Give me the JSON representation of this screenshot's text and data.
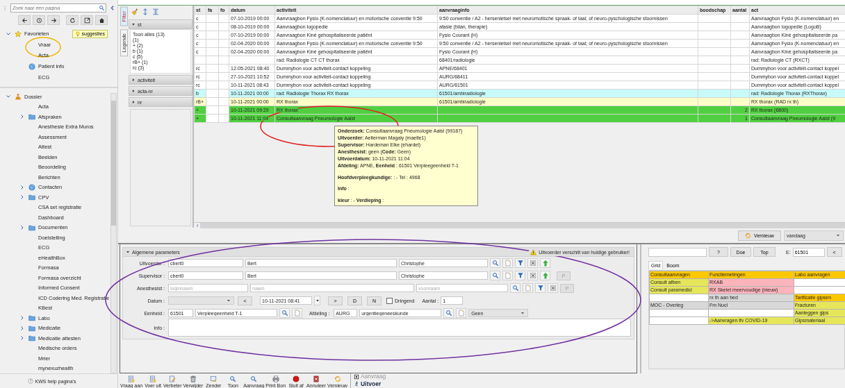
{
  "sidebar": {
    "search": {
      "placeholder": "Zoek naar een pagina"
    },
    "favorites": {
      "label": "Favorieten",
      "expanded": true,
      "suggest_button": "suggesties",
      "items": [
        {
          "label": "Vraar",
          "kind": "page"
        },
        {
          "label": "Acta",
          "kind": "page"
        },
        {
          "label": "Patient info",
          "kind": "globe"
        },
        {
          "label": "ECG",
          "kind": "page"
        }
      ]
    },
    "tree": [
      {
        "label": "Dossier",
        "kind": "person",
        "expanded": true,
        "children": [
          {
            "label": "Acta",
            "kind": "page"
          },
          {
            "label": "Afspraken",
            "kind": "folder",
            "expanded": false
          },
          {
            "label": "Anesthesie Extra Muros",
            "kind": "page"
          },
          {
            "label": "Assessment",
            "kind": "page"
          },
          {
            "label": "Attest",
            "kind": "page"
          },
          {
            "label": "Beelden",
            "kind": "page"
          },
          {
            "label": "Beoordeling",
            "kind": "page"
          },
          {
            "label": "Berichten",
            "kind": "page"
          },
          {
            "label": "Contacten",
            "kind": "globe",
            "expanded": false
          },
          {
            "label": "CPV",
            "kind": "folder",
            "expanded": false
          },
          {
            "label": "CSA set registratie",
            "kind": "page"
          },
          {
            "label": "Dashboard",
            "kind": "page"
          },
          {
            "label": "Documenten",
            "kind": "folder",
            "expanded": false
          },
          {
            "label": "Doelstelling",
            "kind": "page"
          },
          {
            "label": "ECG",
            "kind": "page"
          },
          {
            "label": "eHealthBox",
            "kind": "page"
          },
          {
            "label": "Formasa",
            "kind": "page"
          },
          {
            "label": "Formasa overzicht",
            "kind": "page"
          },
          {
            "label": "Informed Consent",
            "kind": "page"
          },
          {
            "label": "ICD Codering Med. Registratie",
            "kind": "page"
          },
          {
            "label": "KBest",
            "kind": "page"
          },
          {
            "label": "Labo",
            "kind": "folder",
            "expanded": false
          },
          {
            "label": "Medicatie",
            "kind": "folder",
            "expanded": false
          },
          {
            "label": "Medicatie attesten",
            "kind": "folder",
            "expanded": false
          },
          {
            "label": "Medische orders",
            "kind": "page"
          },
          {
            "label": "Mrier",
            "kind": "page"
          },
          {
            "label": "mynexuzhealth",
            "kind": "page"
          }
        ]
      }
    ],
    "help_link": "KWS help pagina's"
  },
  "filter": {
    "tabs": [
      {
        "label": "Filter",
        "selected": true
      },
      {
        "label": "Legende",
        "selected": false
      }
    ],
    "groups": [
      {
        "label": "st",
        "expanded": true,
        "options": [
          "Toon alles (13)",
          "(1)",
          "+ (2)",
          "b (1)",
          "c (5)",
          "rB+ (1)",
          "rc (3)"
        ]
      },
      {
        "label": "activiteit",
        "expanded": false
      },
      {
        "label": "acta-nr",
        "expanded": false
      },
      {
        "label": "nr",
        "expanded": false
      }
    ]
  },
  "table": {
    "columns": [
      "st",
      "fa",
      "fo",
      "datum",
      "activiteit",
      "aanvraaginfo",
      "boodschap",
      "aantal",
      "act"
    ],
    "rows": [
      {
        "st": "c",
        "datum": "07-10-2019 00:00",
        "activiteit": "Aanvraagbon Fysio (K-nomenclatuur) en motorische conventie 9:50",
        "aanvraaginfo": "9:50 conventie / A2 - hersenletsel met neuromotische spraak- of taal; of neuro-pyschologische stoornissen",
        "act": "Aanvraagbon Fysio (K-nomenclatuur) en",
        "color": "#ffffff"
      },
      {
        "st": "c",
        "datum": "08-10-2019 00:00",
        "activiteit": "Aanvraagbon logopedie",
        "aanvraaginfo": "afasie (bilan, therapie)",
        "act": "Aanvraagbon logopedie (LogoB)",
        "color": "#ffffff"
      },
      {
        "st": "c",
        "datum": "07-10-2019 00:00",
        "activiteit": "Aanvraagbon Kiné gehospitaliseerde patiënt",
        "aanvraaginfo": "Fysio Courant (H)",
        "act": "Aanvraagbon Kiné gehospitaliseerde pa",
        "color": "#ffffff"
      },
      {
        "st": "c",
        "datum": "02-04-2020 00:00",
        "activiteit": "Aanvraagbon Fysio (K-nomenclatuur) en motorische conventie 9:50",
        "aanvraaginfo": "9:50 conventie / A2 - hersenletsel met neuromotische spraak- of taal; of neuro-pyschologische stoornissen",
        "act": "Aanvraagbon Fysio (K-nomenclatuur) en",
        "color": "#ffffff"
      },
      {
        "st": "c",
        "datum": "02-04-2020 00:00",
        "activiteit": "Aanvraagbon Kiné gehospitaliseerde patiënt",
        "aanvraaginfo": "Fysio Courant (H)",
        "act": "Aanvraagbon Kiné gehospitaliseerde pa",
        "color": "#ffffff"
      },
      {
        "activiteit": "rad: Radiologie CT CT thorax",
        "aanvraaginfo": "68401/radiologie",
        "act": "rad: Radiologie CT (RXCT)",
        "color": "#ffffff"
      },
      {
        "st": "rc",
        "datum": "12-05-2021 08:40",
        "activiteit": "Dummybon voor activiteit-contact koppeling",
        "aanvraaginfo": "APNE/68401",
        "act": "Dummybon voor activiteit-contact koppel",
        "color": "#ffffff"
      },
      {
        "st": "rc",
        "datum": "27-10-2021 10:52",
        "activiteit": "Dummybon voor activiteit-contact koppeling",
        "aanvraaginfo": "AURG/68411",
        "act": "Dummybon voor activiteit-contact koppel",
        "color": "#ffffff"
      },
      {
        "st": "rc",
        "datum": "10-11-2021 08:43",
        "activiteit": "Dummybon voor activiteit-contact koppeling",
        "aanvraaginfo": "AURG/61501",
        "act": "Dummybon voor activiteit-contact koppel",
        "color": "#ffffff"
      },
      {
        "st": "b",
        "datum": "10-11-2021 00:00",
        "activiteit": "rad: Radiologie Thorax RX thorax",
        "aanvraaginfo": "61501/ambiradiologie",
        "act": "rad: Radiologie Thorax (RXThorax)",
        "color": "#c8fafa"
      },
      {
        "st": "rB+",
        "datum": "10-11-2021 00:00",
        "activiteit": "RX thorax",
        "aanvraaginfo": "61501/ambiradiologie",
        "act": "RX thorax (RAD rx th)",
        "color": "#ffffc8"
      },
      {
        "st": "+",
        "datum": "10-11-2021 09:29",
        "activiteit": "RX thorax",
        "aantal": "2",
        "act": "RX thorax (6800)",
        "color": "#50d040"
      },
      {
        "st": "+",
        "datum": "10-11-2021 11:04",
        "activiteit": "Consultaanvraag Pneumologie Aalst",
        "aantal": "1",
        "act": "Consultaanvraag Pneumologie Aalst (9",
        "color": "#50d040"
      }
    ]
  },
  "tooltip": {
    "sections": [
      [
        "**Onderzoek:** Consultaanvraag Pneumologie Aalst (99187)",
        "**Uitvoerder:** Aelterman Magaly (maelte1)",
        "**Supervisor:** Hardeman Elke (ehardel)",
        "**Anesthesist:** geen (**Code:** Geen)",
        "**Uitvoerdatum:** 10-11-2021 11:04",
        "**Afdeling:** APNE, **Eenheid** : 61501 Verpleegeenheid T-1"
      ],
      [
        "**Hoofdverpleegkundige:** : - Tel : 4968"
      ],
      [
        "**Info** :"
      ],
      [
        "**kleur** : - **Verdieping** :"
      ]
    ]
  },
  "refresh": {
    "button": "Vernieuw",
    "period": "vandaag"
  },
  "form": {
    "title": "Algemene parameters",
    "expanded": true,
    "warning": "Uitvoerder verschilt van huidige gebruiker!",
    "rows": [
      {
        "kind": "person",
        "label": "Uitvoerder :",
        "login": {
          "value": "cbert0"
        },
        "name": {
          "value": "Bert"
        },
        "firstname": {
          "value": "Christophe"
        },
        "arrow": true
      },
      {
        "kind": "person",
        "label": "Supervisor :",
        "login": {
          "value": "cbert0"
        },
        "name": {
          "value": "Bert"
        },
        "firstname": {
          "value": "Christophe"
        },
        "arrow": true,
        "p_button": {
          "label": "P",
          "disabled": true
        }
      },
      {
        "kind": "person",
        "label": "Anesthesist :",
        "login": {
          "placeholder": "loginnaam"
        },
        "name": {
          "placeholder": "naam"
        },
        "firstname": {
          "placeholder": "voornaam"
        },
        "arrow": false,
        "p_button": {
          "label": "P",
          "disabled": true
        }
      },
      {
        "kind": "date",
        "label": "Datum :",
        "prev": "<",
        "date": "10-11-2021 08:41",
        "next": ">",
        "buttons": [
          "D",
          "N"
        ],
        "urgent": {
          "label": "Dringend",
          "checked": false
        },
        "count_label": "Aantal :",
        "count": "1"
      },
      {
        "kind": "unit",
        "label": "Eenheid :",
        "code": "61501",
        "name": "Verpleegeenheid T-1",
        "dept_label": "Afdeling :",
        "dept_code": "AURG",
        "dept_name": "urgentiegeneeskunde",
        "choice": "Geen"
      },
      {
        "kind": "info",
        "label": "Info :"
      }
    ]
  },
  "quick": {
    "buttons": [
      "?",
      "Doe",
      "Top"
    ],
    "e_label": "E:",
    "e_value": "61501",
    "back": "<",
    "tabs": [
      {
        "label": "Grid",
        "selected": true
      },
      {
        "label": "Boom",
        "selected": false
      }
    ],
    "grid": [
      [
        {
          "text": "Consultaanvragen",
          "color": "#ffc800"
        },
        {
          "text": "Functiemetingen",
          "color": "#ffc800"
        },
        {
          "text": "Labo aanvragen",
          "color": "#ffc800"
        }
      ],
      [
        {
          "text": "Consult afben",
          "color": "#e6e65a"
        },
        {
          "text": "RXAB",
          "color": "#ffb4bc"
        },
        {
          "color": "#ffffff"
        }
      ],
      [
        {
          "text": "Consult paramedici",
          "color": "#e6e65a"
        },
        {
          "text": "RX Skelet meervoudige (nieuw)",
          "color": "#ffb4bc"
        },
        {
          "color": "#ffffff"
        }
      ],
      [
        {
          "color": "#ffffff"
        },
        {
          "text": "rx th aan bed",
          "color": "#d8d8d8"
        },
        {
          "text": "Tarificatie gipsen",
          "color": "#ffc800"
        }
      ],
      [
        {
          "text": "MOC - Overleg",
          "color": "#d8d8d8"
        },
        {
          "text": "Fm Nucl",
          "color": "#d8d8d8"
        },
        {
          "text": "Fracturen",
          "color": "#e6e65a"
        }
      ],
      [
        {
          "color": "#ffffff"
        },
        {
          "color": "#ffffff"
        },
        {
          "text": "Aanleggen gips",
          "color": "#e6e65a"
        }
      ],
      [
        {
          "color": "#ffffff"
        },
        {
          "text": "->Aanvragen ifv COVID-19",
          "color": "#e6e65a"
        },
        {
          "text": "Gipsmateriaal",
          "color": "#e6e65a"
        }
      ]
    ]
  },
  "toolbar": {
    "buttons": [
      "Vraag aan",
      "Voer uit",
      "Verbeter",
      "Verwijder",
      "Zender",
      "Toon",
      "Aanvraag",
      "Print Bon",
      "Sluit af",
      "Annuleer",
      "Vernieuw"
    ],
    "modes": [
      {
        "label": "Aanvraag",
        "selected": false
      },
      {
        "label": "Uitvoer",
        "selected": true
      }
    ]
  }
}
